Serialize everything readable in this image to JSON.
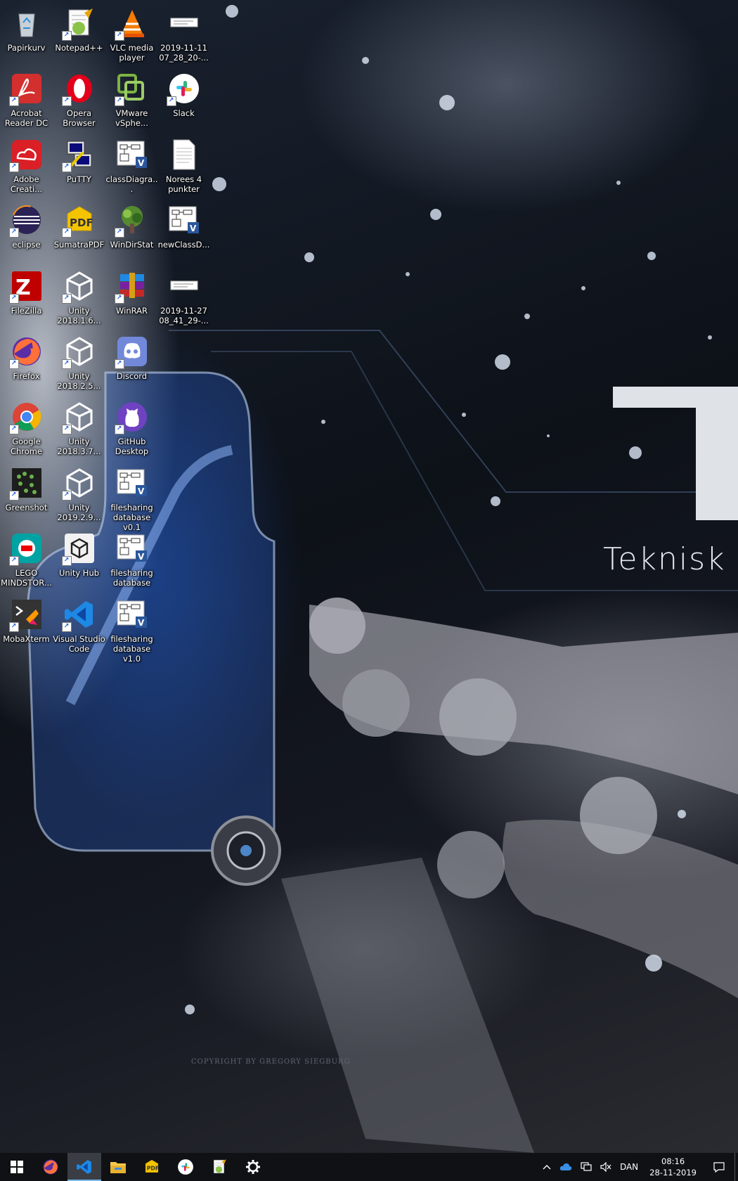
{
  "wallpaper": {
    "text": "Teknisk E",
    "copyright": "COPYRIGHT BY GREGORY SIEGBURG"
  },
  "desktop_icons": [
    {
      "label": "Papirkurv",
      "icon": "recycle-bin-icon",
      "color": "#cfd6dd"
    },
    {
      "label": "Acrobat Reader DC",
      "icon": "acrobat-icon",
      "color": "#d32f2f"
    },
    {
      "label": "Adobe Creati...",
      "icon": "creative-cloud-icon",
      "color": "#da1f26"
    },
    {
      "label": "eclipse",
      "icon": "eclipse-icon",
      "color": "#2c2255"
    },
    {
      "label": "FileZilla",
      "icon": "filezilla-icon",
      "color": "#bf0000"
    },
    {
      "label": "Firefox",
      "icon": "firefox-icon",
      "color": "#ff7139"
    },
    {
      "label": "Google Chrome",
      "icon": "chrome-icon",
      "color": "#4caf50"
    },
    {
      "label": "Greenshot",
      "icon": "greenshot-icon",
      "color": "#6ab04c"
    },
    {
      "label": "LEGO MINDSTOR...",
      "icon": "lego-mindstorms-icon",
      "color": "#00a3a3"
    },
    {
      "label": "MobaXterm",
      "icon": "mobaxterm-icon",
      "color": "#333"
    },
    {
      "label": "Notepad++",
      "icon": "notepadpp-icon",
      "color": "#8bc34a"
    },
    {
      "label": "Opera Browser",
      "icon": "opera-icon",
      "color": "#e3001b"
    },
    {
      "label": "PuTTY",
      "icon": "putty-icon",
      "color": "#2a5fb0"
    },
    {
      "label": "SumatraPDF",
      "icon": "sumatrapdf-icon",
      "color": "#f5c400"
    },
    {
      "label": "Unity 2018.1.6...",
      "icon": "unity-icon",
      "color": "#222"
    },
    {
      "label": "Unity 2018.2.5...",
      "icon": "unity-icon",
      "color": "#222"
    },
    {
      "label": "Unity 2018.3.7...",
      "icon": "unity-icon",
      "color": "#222"
    },
    {
      "label": "Unity 2019.2.9...",
      "icon": "unity-icon",
      "color": "#222"
    },
    {
      "label": "Unity Hub",
      "icon": "unity-hub-icon",
      "color": "#f0f0f0"
    },
    {
      "label": "Visual Studio Code",
      "icon": "vscode-icon",
      "color": "#1e88e5"
    },
    {
      "label": "VLC media player",
      "icon": "vlc-icon",
      "color": "#f57c00"
    },
    {
      "label": "VMware vSphe...",
      "icon": "vmware-icon",
      "color": "#7cb342"
    },
    {
      "label": "classDiagra...",
      "icon": "visio-document-icon",
      "color": "#2b579a"
    },
    {
      "label": "WinDirStat",
      "icon": "windirstat-icon",
      "color": "#558b2f"
    },
    {
      "label": "WinRAR",
      "icon": "winrar-icon",
      "color": "#7b1fa2"
    },
    {
      "label": "Discord",
      "icon": "discord-icon",
      "color": "#7289da"
    },
    {
      "label": "GitHub Desktop",
      "icon": "github-desktop-icon",
      "color": "#6f42c1"
    },
    {
      "label": "filesharing database v0.1",
      "icon": "visio-document-icon",
      "color": "#2b579a"
    },
    {
      "label": "filesharing database",
      "icon": "visio-document-icon",
      "color": "#2b579a"
    },
    {
      "label": "filesharing database v1.0",
      "icon": "visio-document-icon",
      "color": "#2b579a"
    },
    {
      "label": "2019-11-11 07_28_20-...",
      "icon": "image-file-icon",
      "color": "#ffffff"
    },
    {
      "label": "Slack",
      "icon": "slack-icon",
      "color": "#ffffff"
    },
    {
      "label": "Norees 4 punkter",
      "icon": "text-document-icon",
      "color": "#ffffff"
    },
    {
      "label": "newClassD...",
      "icon": "visio-document-icon",
      "color": "#2b579a"
    },
    {
      "label": "2019-11-27 08_41_29-...",
      "icon": "image-file-icon",
      "color": "#ffffff"
    }
  ],
  "taskbar": {
    "pinned": [
      {
        "icon": "windows-start-icon",
        "active": false
      },
      {
        "icon": "firefox-icon",
        "active": false
      },
      {
        "icon": "vscode-icon",
        "active": true
      },
      {
        "icon": "file-explorer-icon",
        "active": false
      },
      {
        "icon": "sumatrapdf-icon",
        "active": false
      },
      {
        "icon": "slack-icon",
        "active": false
      },
      {
        "icon": "notepadpp-icon",
        "active": false
      },
      {
        "icon": "settings-gear-icon",
        "active": false
      }
    ],
    "tray": {
      "language": "DAN",
      "time": "08:16",
      "date": "28-11-2019"
    }
  }
}
